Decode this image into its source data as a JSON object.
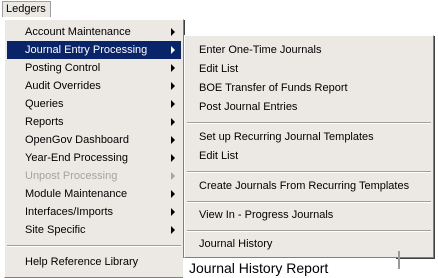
{
  "menubar": {
    "ledgers_label": "Ledgers"
  },
  "main_menu": {
    "items": [
      {
        "label": "Account Maintenance",
        "submenu": true
      },
      {
        "label": "Journal Entry Processing",
        "submenu": true,
        "selected": true
      },
      {
        "label": "Posting Control",
        "submenu": true
      },
      {
        "label": "Audit Overrides",
        "submenu": true
      },
      {
        "label": "Queries",
        "submenu": true
      },
      {
        "label": "Reports",
        "submenu": true
      },
      {
        "label": "OpenGov Dashboard",
        "submenu": true
      },
      {
        "label": "Year-End Processing",
        "submenu": true
      },
      {
        "label": "Unpost Processing",
        "submenu": true,
        "disabled": true
      },
      {
        "label": "Module Maintenance",
        "submenu": true
      },
      {
        "label": "Interfaces/Imports",
        "submenu": true
      },
      {
        "label": "Site Specific",
        "submenu": true
      },
      {
        "label": "Help Reference Library",
        "submenu": false
      }
    ]
  },
  "sub_menu": {
    "items": [
      {
        "label": "Enter One-Time Journals"
      },
      {
        "label": "Edit List"
      },
      {
        "label": "BOE Transfer of Funds Report"
      },
      {
        "label": "Post Journal Entries"
      },
      {
        "label": "Set up Recurring Journal Templates"
      },
      {
        "label": "Edit List"
      },
      {
        "label": "Create Journals From Recurring Templates"
      },
      {
        "label": "View In - Progress Journals"
      },
      {
        "label": "Journal History"
      }
    ]
  },
  "tooltip": {
    "text": "Journal History Report"
  },
  "colors": {
    "highlight": "#0a246a",
    "menu_bg": "#ece9e4",
    "disabled_text": "#a6a39c"
  }
}
